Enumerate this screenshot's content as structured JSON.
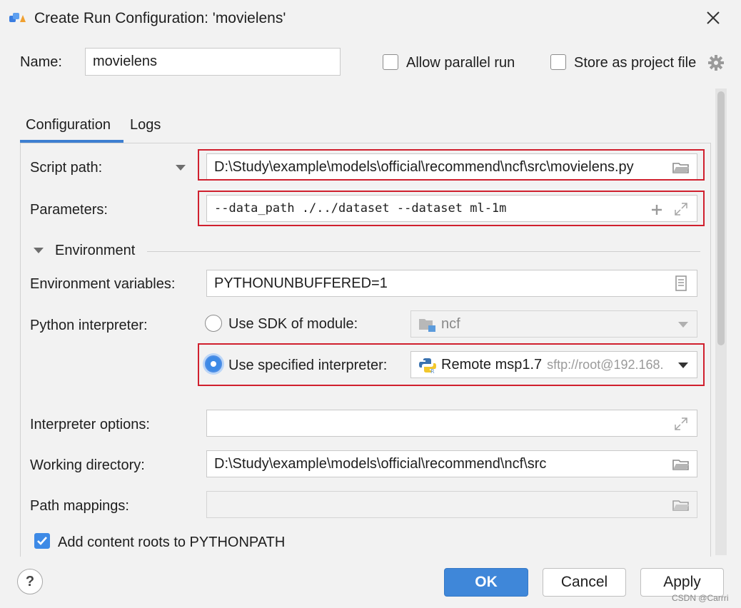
{
  "dialog": {
    "title": "Create Run Configuration: 'movielens'"
  },
  "name_row": {
    "label": "Name:",
    "value": "movielens",
    "allow_parallel_label": "Allow parallel run",
    "allow_parallel_checked": false,
    "store_project_label": "Store as project file",
    "store_project_checked": false
  },
  "tabs": [
    {
      "label": "Configuration",
      "active": true
    },
    {
      "label": "Logs",
      "active": false
    }
  ],
  "form": {
    "script_path_label": "Script path:",
    "script_path_value": "D:\\Study\\example\\models\\official\\recommend\\ncf\\src\\movielens.py",
    "parameters_label": "Parameters:",
    "parameters_value": "--data_path ./../dataset --dataset ml-1m",
    "environment_section": "Environment",
    "env_vars_label": "Environment variables:",
    "env_vars_value": "PYTHONUNBUFFERED=1",
    "python_interpreter_label": "Python interpreter:",
    "use_sdk_label": "Use SDK of module:",
    "sdk_module_value": "ncf",
    "use_specified_label": "Use specified interpreter:",
    "interpreter_name": "Remote msp1.7",
    "interpreter_detail": "sftp://root@192.168.",
    "interpreter_options_label": "Interpreter options:",
    "interpreter_options_value": "",
    "working_dir_label": "Working directory:",
    "working_dir_value": "D:\\Study\\example\\models\\official\\recommend\\ncf\\src",
    "path_mappings_label": "Path mappings:",
    "path_mappings_value": "",
    "add_content_roots_label": "Add content roots to PYTHONPATH",
    "add_content_roots_checked": true
  },
  "footer": {
    "help_label": "?",
    "ok_label": "OK",
    "cancel_label": "Cancel",
    "apply_label": "Apply",
    "watermark": "CSDN @Carrri"
  },
  "colors": {
    "accent": "#3f87d9",
    "highlight_border": "#d0202e",
    "tab_underline": "#3d7fd1"
  }
}
